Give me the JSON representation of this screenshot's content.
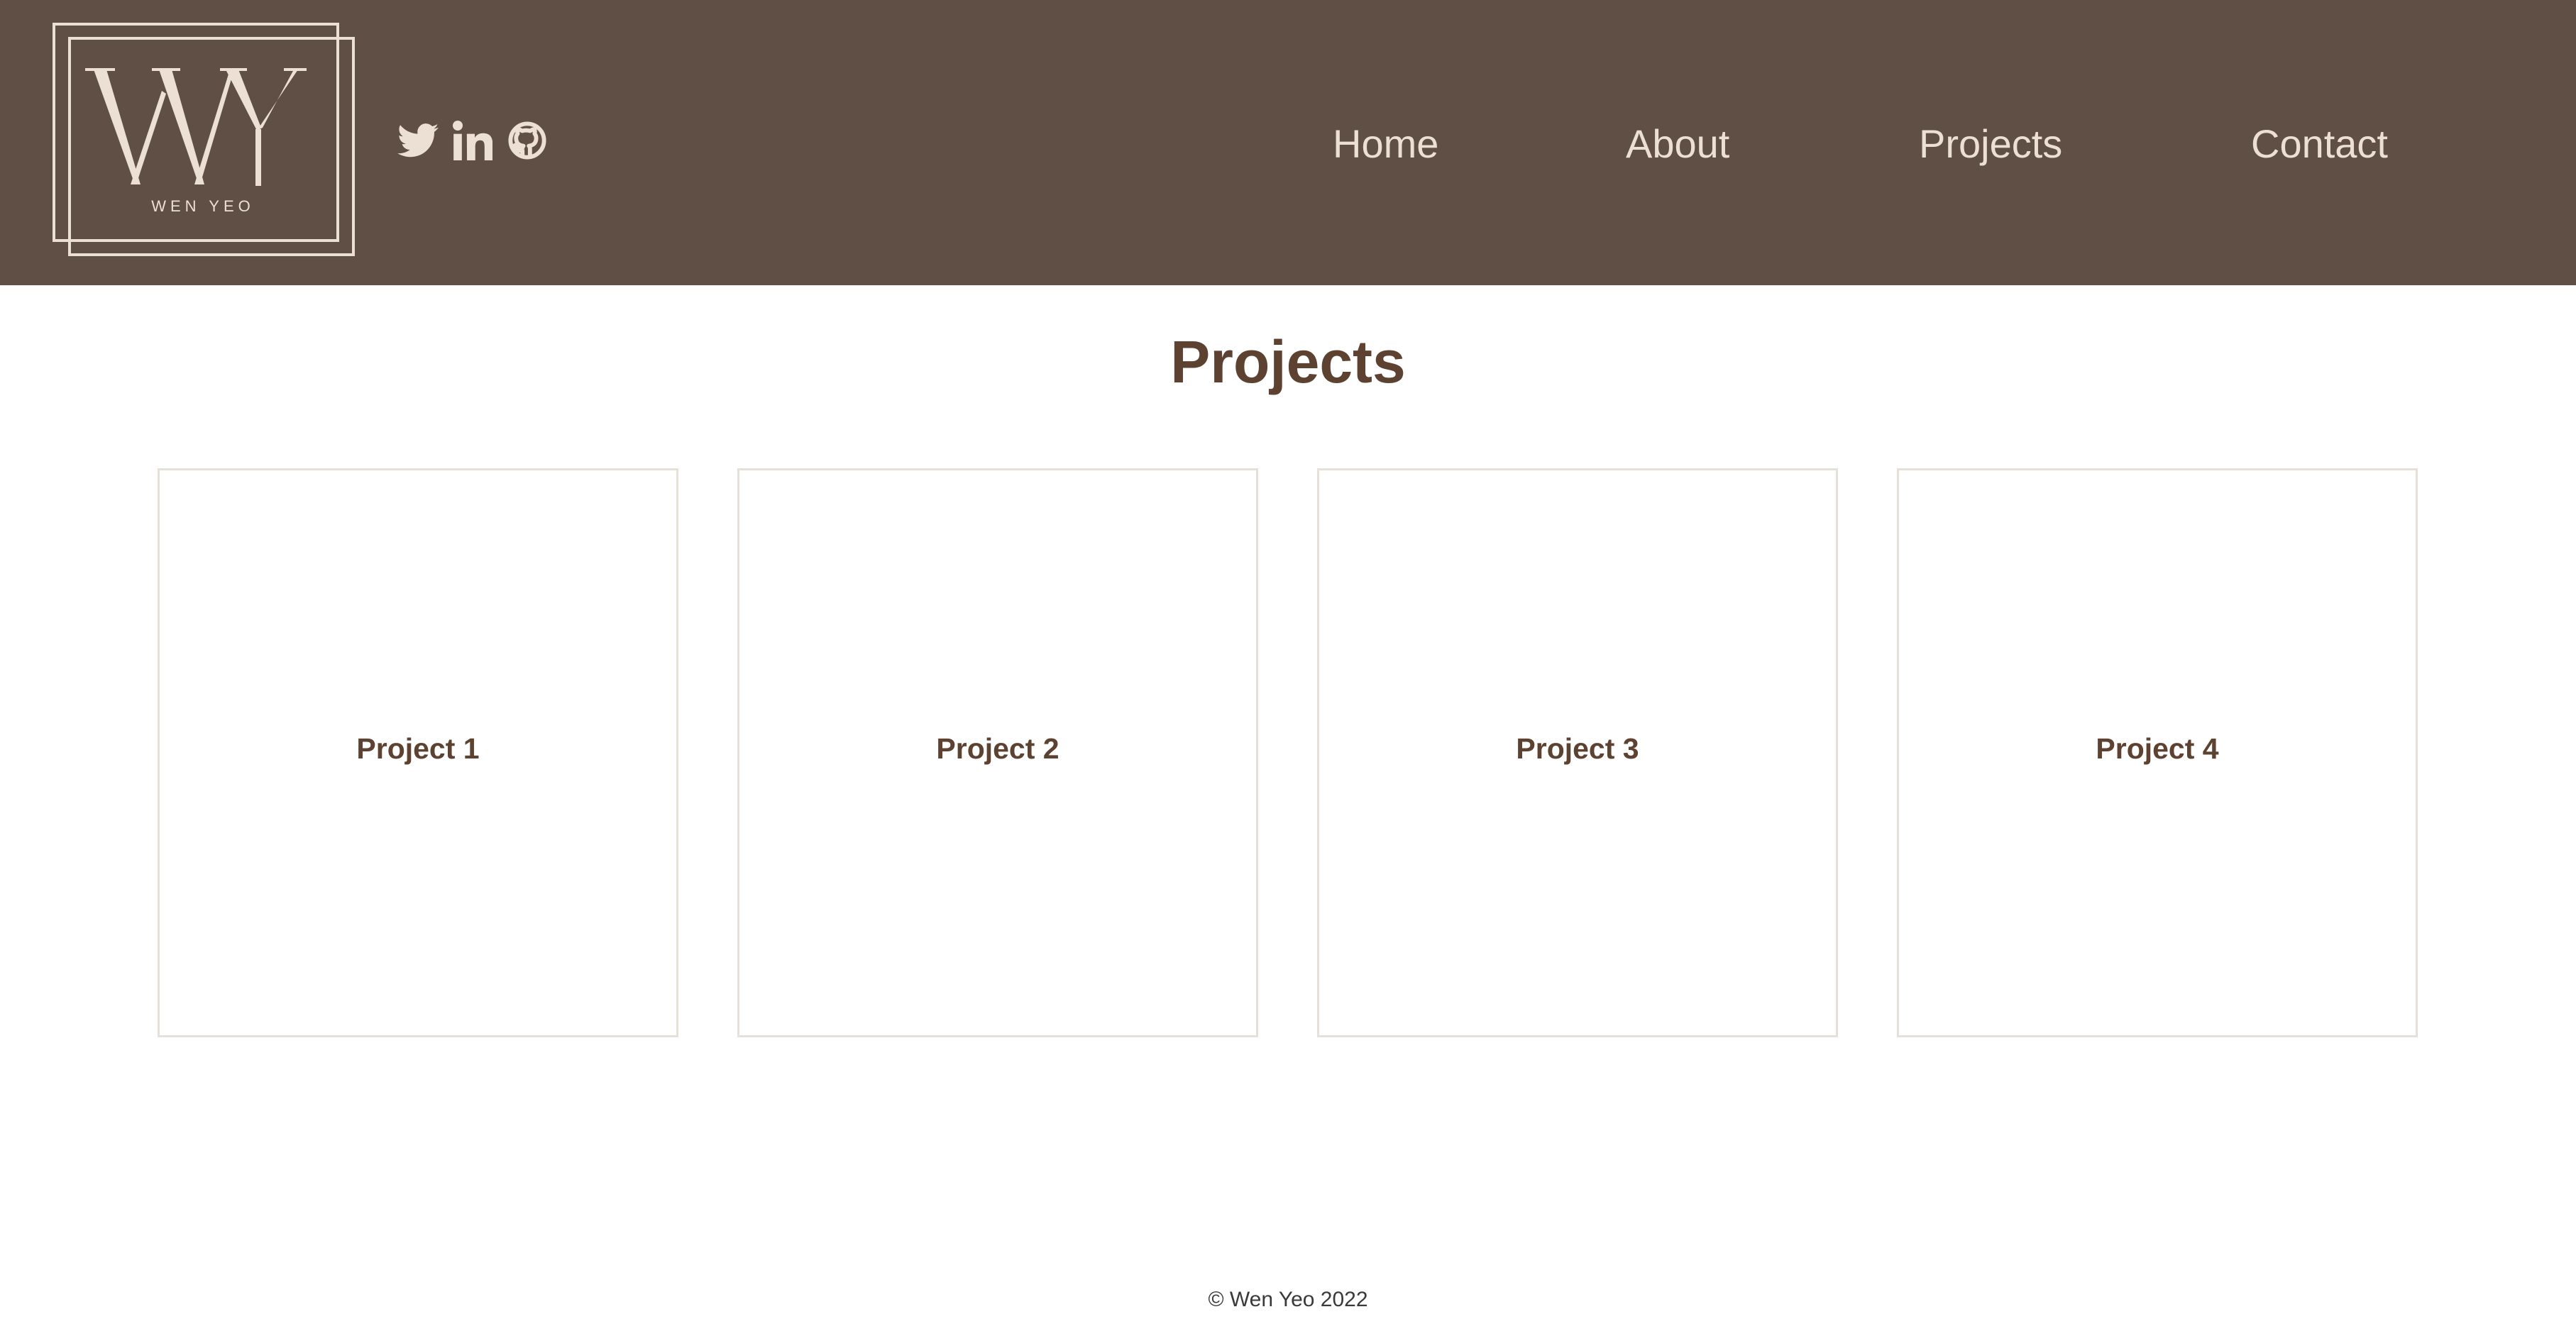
{
  "colors": {
    "header_bg": "#5f4f44",
    "nav_text": "#ecdfd4",
    "accent_text": "#5d4232",
    "card_border": "#e6e0d9"
  },
  "logo": {
    "monogram": "WY",
    "name": "WEN YEO"
  },
  "social": [
    {
      "icon": "twitter-icon"
    },
    {
      "icon": "linkedin-icon"
    },
    {
      "icon": "github-icon"
    }
  ],
  "nav": {
    "home": "Home",
    "about": "About",
    "projects": "Projects",
    "contact": "Contact"
  },
  "main": {
    "title": "Projects",
    "cards": [
      {
        "label": "Project 1"
      },
      {
        "label": "Project 2"
      },
      {
        "label": "Project 3"
      },
      {
        "label": "Project 4"
      }
    ]
  },
  "footer": {
    "copyright": "© Wen Yeo 2022"
  }
}
